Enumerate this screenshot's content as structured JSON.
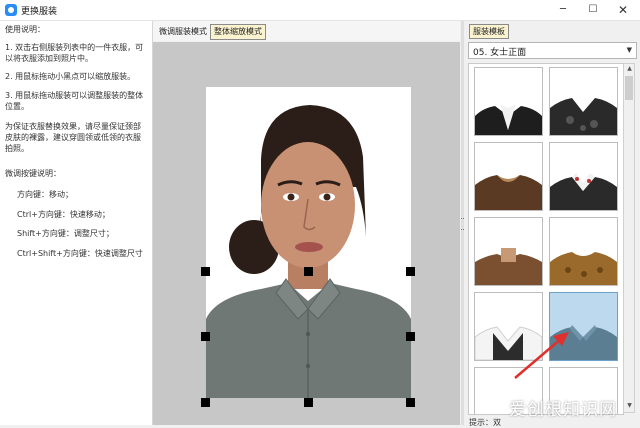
{
  "window": {
    "title": "更换服装"
  },
  "left_panel": {
    "heading": "使用说明：",
    "tips": [
      "1. 双击右侧服装列表中的一件衣服，可以将衣服添加到照片中。",
      "2. 用鼠标拖动小黑点可以缩放服装。",
      "3. 用鼠标拖动服装可以调整服装的整体位置。",
      "为保证衣服替换效果，请尽量保证颈部皮肤的裸露，建议穿圆领或低领的衣服拍照。"
    ],
    "keys_heading": "微调按键说明：",
    "keys": [
      "方向键：移动；",
      "Ctrl+方向键：快速移动；",
      "Shift+方向键：调整尺寸；",
      "Ctrl+Shift+方向键：快速调整尺寸"
    ]
  },
  "center": {
    "tabs": [
      "微调服装模式",
      "整体缩放模式"
    ],
    "active_tab": 1
  },
  "right_panel": {
    "tab_label": "服装模板",
    "category": "05. 女士正面",
    "hint_label": "提示：双"
  },
  "watermark": "爱创根知识网",
  "colors": {
    "tab_active_bg": "#fbf3cf",
    "workspace_bg": "#c7c7c7",
    "selected_thumb": "#bcd9ee",
    "arrow": "#e0302e"
  }
}
